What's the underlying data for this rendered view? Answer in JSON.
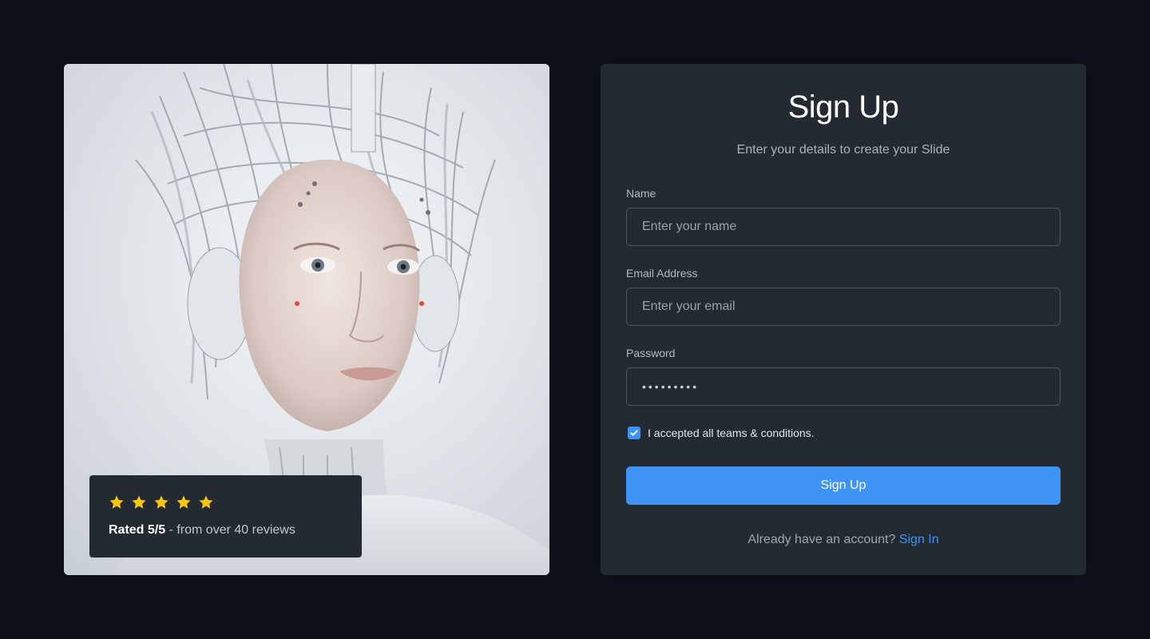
{
  "rating_card": {
    "stars_count": 5,
    "star_color": "#f5c518",
    "rating_bold": "Rated 5/5",
    "rating_rest": " - from over 40 reviews"
  },
  "form": {
    "title": "Sign Up",
    "subtitle": "Enter your details to create your Slide",
    "name": {
      "label": "Name",
      "placeholder": "Enter your name",
      "value": ""
    },
    "email": {
      "label": "Email Address",
      "placeholder": "Enter your email",
      "value": ""
    },
    "password": {
      "label": "Password",
      "value": "•••••••••"
    },
    "terms": {
      "label": "I accepted all teams & conditions.",
      "checked": true
    },
    "submit_label": "Sign Up",
    "signin_prompt": "Already have an account?",
    "signin_link": "Sign In"
  },
  "colors": {
    "page_bg": "#0c111b",
    "card_bg": "#232a31",
    "accent": "#3f93f4"
  }
}
